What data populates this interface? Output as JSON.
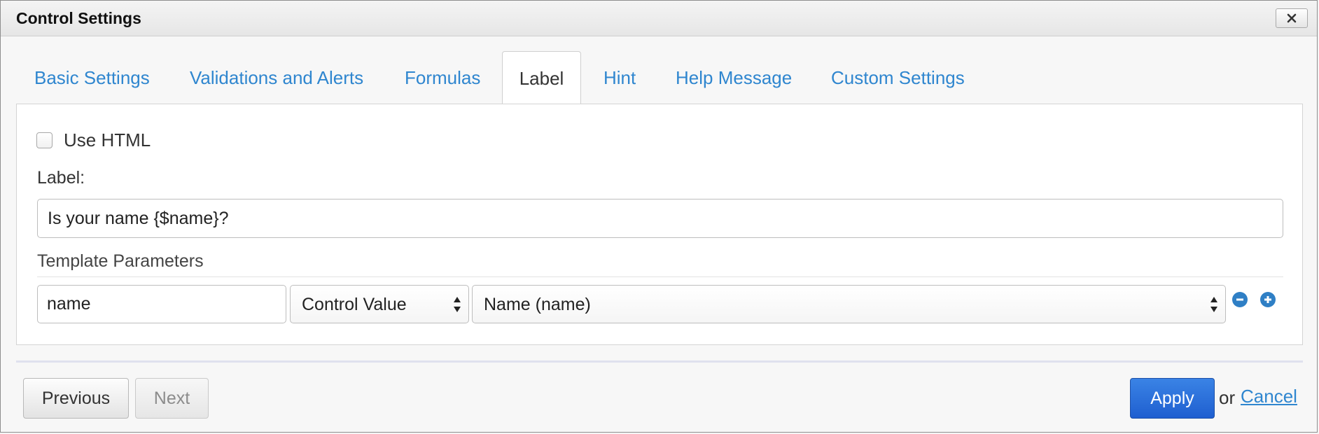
{
  "dialog": {
    "title": "Control Settings"
  },
  "tabs": [
    {
      "label": "Basic Settings",
      "active": false
    },
    {
      "label": "Validations and Alerts",
      "active": false
    },
    {
      "label": "Formulas",
      "active": false
    },
    {
      "label": "Label",
      "active": true
    },
    {
      "label": "Hint",
      "active": false
    },
    {
      "label": "Help Message",
      "active": false
    },
    {
      "label": "Custom Settings",
      "active": false
    }
  ],
  "label_panel": {
    "use_html": {
      "label": "Use HTML",
      "checked": false
    },
    "label_field": {
      "caption": "Label:",
      "value": "Is your name {$name}?"
    },
    "template_parameters": {
      "caption": "Template Parameters",
      "rows": [
        {
          "name": "name",
          "type": "Control Value",
          "control": "Name (name)"
        }
      ]
    }
  },
  "footer": {
    "previous_label": "Previous",
    "next_label": "Next",
    "apply_label": "Apply",
    "or_text": "or",
    "cancel_label": "Cancel"
  },
  "colors": {
    "link": "#2f86cf",
    "primary": "#2a6fdb",
    "icon_blue": "#2f7fc5"
  }
}
